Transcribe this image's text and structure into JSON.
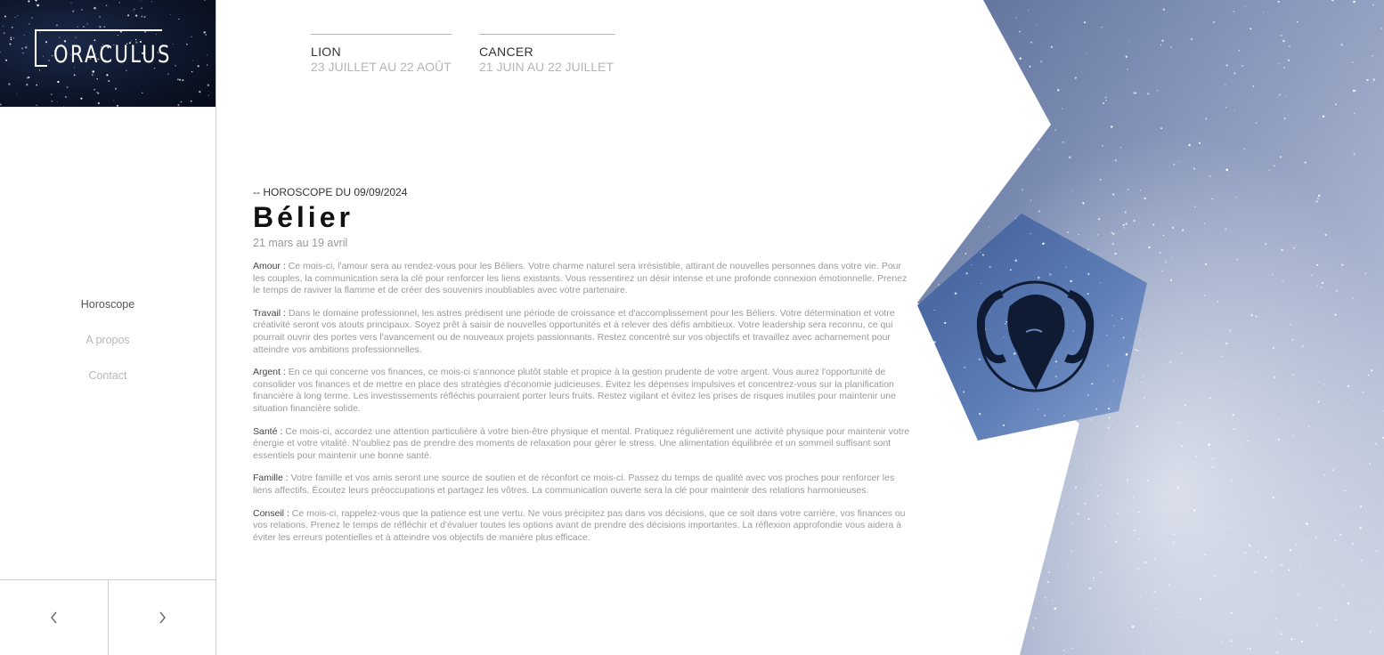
{
  "brand": {
    "logo_text": "ORACULUS"
  },
  "nav": {
    "items": [
      {
        "label": "Horoscope",
        "active": true
      },
      {
        "label": "A propos",
        "active": false
      },
      {
        "label": "Contact",
        "active": false
      }
    ]
  },
  "pager": {
    "prev_icon": "chevron-left-icon",
    "next_icon": "chevron-right-icon"
  },
  "sign_tabs": [
    {
      "name": "LION",
      "dates": "23 JUILLET AU 22 AOÛT"
    },
    {
      "name": "CANCER",
      "dates": "21 JUIN AU 22 JUILLET"
    }
  ],
  "horoscope": {
    "subtitle": "-- HOROSCOPE DU 09/09/2024",
    "sign": "Bélier",
    "range": "21 mars au 19 avril",
    "sections": [
      {
        "label": "Amour :",
        "text": " Ce mois-ci, l'amour sera au rendez-vous pour les Béliers. Votre charme naturel sera irrésistible, attirant de nouvelles personnes dans votre vie. Pour les couples, la communication sera la clé pour renforcer les liens existants. Vous ressentirez un désir intense et une profonde connexion émotionnelle. Prenez le temps de raviver la flamme et de créer des souvenirs inoubliables avec votre partenaire."
      },
      {
        "label": "Travail :",
        "text": " Dans le domaine professionnel, les astres prédisent une période de croissance et d'accomplissement pour les Béliers. Votre détermination et votre créativité seront vos atouts principaux. Soyez prêt à saisir de nouvelles opportunités et à relever des défis ambitieux. Votre leadership sera reconnu, ce qui pourrait ouvrir des portes vers l'avancement ou de nouveaux projets passionnants. Restez concentré sur vos objectifs et travaillez avec acharnement pour atteindre vos ambitions professionnelles."
      },
      {
        "label": "Argent :",
        "text": " En ce qui concerne vos finances, ce mois-ci s'annonce plutôt stable et propice à la gestion prudente de votre argent. Vous aurez l'opportunité de consolider vos finances et de mettre en place des stratégies d'économie judicieuses. Évitez les dépenses impulsives et concentrez-vous sur la planification financière à long terme. Les investissements réfléchis pourraient porter leurs fruits. Restez vigilant et évitez les prises de risques inutiles pour maintenir une situation financière solide."
      },
      {
        "label": "Santé :",
        "text": " Ce mois-ci, accordez une attention particulière à votre bien-être physique et mental. Pratiquez régulièrement une activité physique pour maintenir votre énergie et votre vitalité. N'oubliez pas de prendre des moments de relaxation pour gérer le stress. Une alimentation équilibrée et un sommeil suffisant sont essentiels pour maintenir une bonne santé."
      },
      {
        "label": "Famille :",
        "text": " Votre famille et vos amis seront une source de soutien et de réconfort ce mois-ci. Passez du temps de qualité avec vos proches pour renforcer les liens affectifs. Écoutez leurs préoccupations et partagez les vôtres. La communication ouverte sera la clé pour maintenir des relations harmonieuses."
      },
      {
        "label": "Conseil :",
        "text": " Ce mois-ci, rappelez-vous que la patience est une vertu. Ne vous précipitez pas dans vos décisions, que ce soit dans votre carrière, vos finances ou vos relations. Prenez le temps de réfléchir et d'évaluer toutes les options avant de prendre des décisions importantes. La réflexion approfondie vous aidera à éviter les erreurs potentielles et à atteindre vos objectifs de manière plus efficace."
      }
    ]
  },
  "emblem": {
    "icon": "aries-ram-icon"
  },
  "colors": {
    "sky_dark": "#1e3566",
    "sky_light": "#c9d3e6",
    "pentagon": "#4a6aa6",
    "emblem": "#0f1b33"
  }
}
